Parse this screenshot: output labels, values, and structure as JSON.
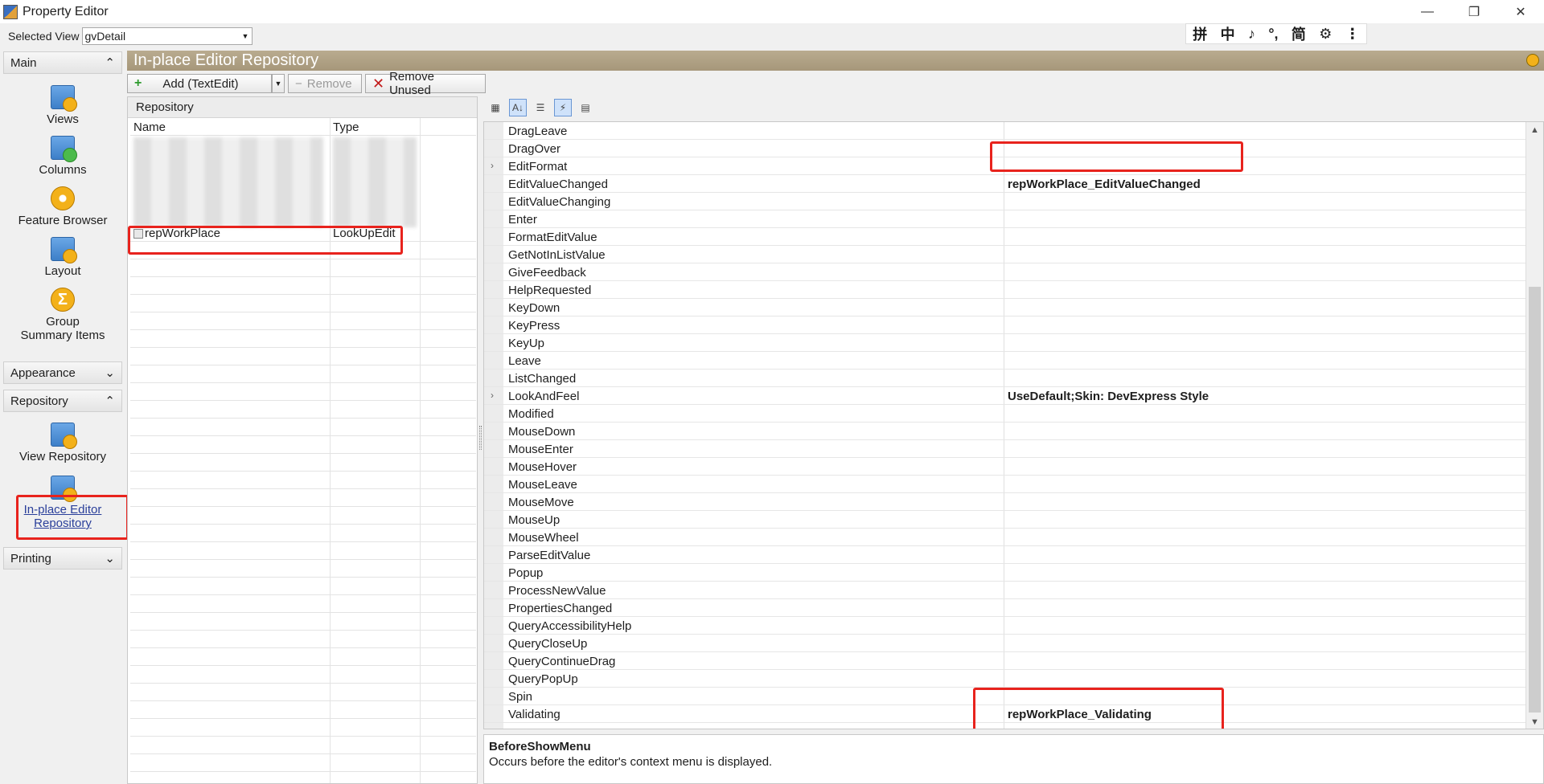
{
  "window": {
    "title": "Property Editor",
    "minimize": "—",
    "restore": "❐",
    "close": "✕"
  },
  "selected_view": {
    "label": "Selected View",
    "value": "gvDetail"
  },
  "ime_bar": [
    "拼",
    "中",
    "♪",
    "°,",
    "简",
    "⚙",
    "⋮"
  ],
  "nav": {
    "main": "Main",
    "views": "Views",
    "columns": "Columns",
    "feature_browser": "Feature Browser",
    "layout": "Layout",
    "group_summary": "Group Summary Items",
    "appearance": "Appearance",
    "repository": "Repository",
    "view_repository": "View Repository",
    "inplace_editor_repository": "In-place Editor Repository",
    "printing": "Printing"
  },
  "header": {
    "title": "In-place Editor Repository"
  },
  "toolbar": {
    "add_label": "Add (TextEdit)",
    "remove_label": "Remove",
    "remove_unused_label": "Remove Unused"
  },
  "repository": {
    "caption": "Repository",
    "col_name": "Name",
    "col_type": "Type",
    "selected_row": {
      "name": "repWorkPlace",
      "type": "LookUpEdit"
    }
  },
  "property_grid": {
    "rows": [
      {
        "name": "DragLeave",
        "value": ""
      },
      {
        "name": "DragOver",
        "value": ""
      },
      {
        "name": "EditFormat",
        "value": "",
        "expandable": true
      },
      {
        "name": "EditValueChanged",
        "value": "repWorkPlace_EditValueChanged"
      },
      {
        "name": "EditValueChanging",
        "value": ""
      },
      {
        "name": "Enter",
        "value": ""
      },
      {
        "name": "FormatEditValue",
        "value": ""
      },
      {
        "name": "GetNotInListValue",
        "value": ""
      },
      {
        "name": "GiveFeedback",
        "value": ""
      },
      {
        "name": "HelpRequested",
        "value": ""
      },
      {
        "name": "KeyDown",
        "value": ""
      },
      {
        "name": "KeyPress",
        "value": ""
      },
      {
        "name": "KeyUp",
        "value": ""
      },
      {
        "name": "Leave",
        "value": ""
      },
      {
        "name": "ListChanged",
        "value": ""
      },
      {
        "name": "LookAndFeel",
        "value": "UseDefault;Skin: DevExpress Style",
        "expandable": true
      },
      {
        "name": "Modified",
        "value": ""
      },
      {
        "name": "MouseDown",
        "value": ""
      },
      {
        "name": "MouseEnter",
        "value": ""
      },
      {
        "name": "MouseHover",
        "value": ""
      },
      {
        "name": "MouseLeave",
        "value": ""
      },
      {
        "name": "MouseMove",
        "value": ""
      },
      {
        "name": "MouseUp",
        "value": ""
      },
      {
        "name": "MouseWheel",
        "value": ""
      },
      {
        "name": "ParseEditValue",
        "value": ""
      },
      {
        "name": "Popup",
        "value": ""
      },
      {
        "name": "ProcessNewValue",
        "value": ""
      },
      {
        "name": "PropertiesChanged",
        "value": ""
      },
      {
        "name": "QueryAccessibilityHelp",
        "value": ""
      },
      {
        "name": "QueryCloseUp",
        "value": ""
      },
      {
        "name": "QueryContinueDrag",
        "value": ""
      },
      {
        "name": "QueryPopUp",
        "value": ""
      },
      {
        "name": "Spin",
        "value": ""
      },
      {
        "name": "Validating",
        "value": "repWorkPlace_Validating"
      }
    ]
  },
  "description": {
    "title": "BeforeShowMenu",
    "text": "Occurs before the editor's context menu is displayed."
  },
  "colors": {
    "highlight": "#e8231d",
    "header": "#b0a285",
    "link": "#2a3f9a"
  }
}
